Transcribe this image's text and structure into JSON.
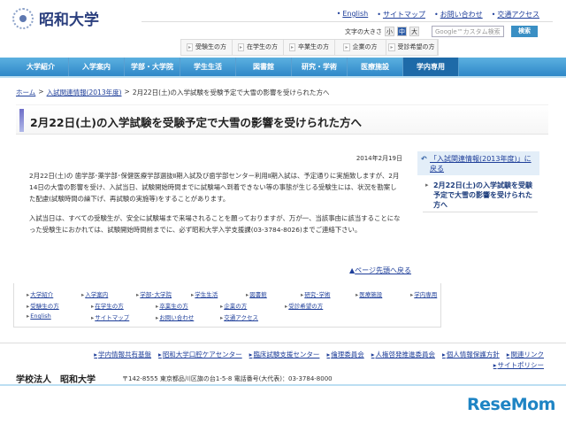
{
  "header": {
    "logo_text": "昭和大学",
    "top_links": [
      "English",
      "サイトマップ",
      "お問い合わせ",
      "交通アクセス"
    ],
    "font_size_label": "文字の大きさ",
    "font_sizes": [
      "小",
      "中",
      "大"
    ],
    "font_size_selected": "中",
    "search_placeholder": "Google™カスタム検索",
    "search_button": "検索",
    "audience_tabs": [
      "受験生の方",
      "在学生の方",
      "卒業生の方",
      "企業の方",
      "受診希望の方"
    ]
  },
  "nav": {
    "items": [
      "大学紹介",
      "入学案内",
      "学部・大学院",
      "学生生活",
      "図書館",
      "研究・学術",
      "医療施設",
      "学内専用"
    ],
    "active": "学内専用",
    "color": "#2f88c8"
  },
  "breadcrumb": {
    "items": [
      "ホーム",
      "入試関連情報(2013年度)"
    ],
    "sep": ">",
    "current": "2月22日(土)の入学試験を受験予定で大雪の影響を受けられた方へ"
  },
  "main": {
    "title": "2月22日(土)の入学試験を受験予定で大雪の影響を受けられた方へ",
    "date": "2014年2月19日",
    "paragraphs": [
      "2月22日(土)の 歯学部･薬学部･保健医療学部選抜Ⅱ期入試及び歯学部センター利用Ⅱ期入試は、予定通りに実施致しますが、2月14日の大雪の影響を受け、入試当日、試験開始時間までに試験場へ到着できない等の事態が生じる受験生には、状況を勘案した配慮(試験時間の繰下げ、再試験の実施等)をすることがあります。",
      "入試当日は、すべての受験生が、安全に試験場まで来場されることを願っておりますが、万が一、当該事由に該当することになった受験生におかれては、試験開始時間前までに、必ず昭和大学入学支援課(03-3784-8026)までご連絡下さい。"
    ],
    "page_top": "ページ先頭へ戻る"
  },
  "sidebar": {
    "back_link": "「入試関連情報(2013年度)」に戻る",
    "current_item": "2月22日(土)の入学試験を受験予定で大雪の影響を受けられた方へ"
  },
  "footer_nav": {
    "rows": [
      [
        "大学紹介",
        "入学案内",
        "学部･大学院",
        "学生生活",
        "図書館",
        "研究･学術",
        "医療施設",
        "学内専用"
      ],
      [
        "受験生の方",
        "在学生の方",
        "卒業生の方",
        "企業の方",
        "受診希望の方"
      ],
      [
        "English",
        "サイトマップ",
        "お問い合わせ",
        "交通アクセス"
      ]
    ]
  },
  "footer": {
    "links": [
      "学内情報共有基盤",
      "昭和大学口腔ケアセンター",
      "臨床試験支援センター",
      "倫理委員会",
      "人権啓発推進委員会",
      "個人情報保護方針",
      "関連リンク",
      "サイトポリシー"
    ],
    "corp": "学校法人　昭和大学",
    "address": "〒142-8555  東京都品川区旗の台1-5-8  電話番号(大代表)：03-3784-8000"
  },
  "watermark": "ReseMom"
}
